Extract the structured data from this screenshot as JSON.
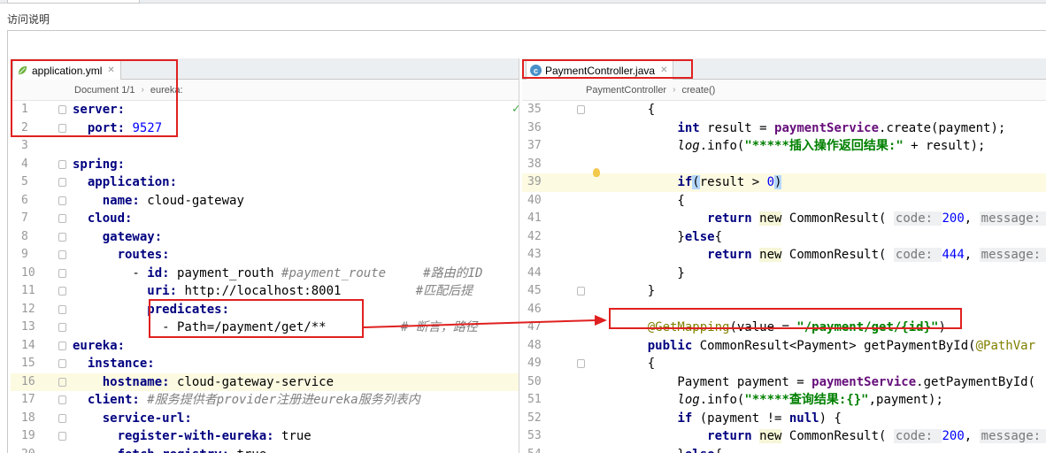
{
  "page": {
    "title": "访问说明"
  },
  "left_editor": {
    "tab_label": "application.yml",
    "breadcrumb": [
      "Document 1/1",
      "eureka:"
    ],
    "lines": [
      {
        "n": "1",
        "segs": [
          [
            "server:",
            "k"
          ]
        ]
      },
      {
        "n": "2",
        "segs": [
          [
            "  port: ",
            "k"
          ],
          [
            "9527",
            "n"
          ]
        ]
      },
      {
        "n": "3",
        "segs": []
      },
      {
        "n": "4",
        "segs": [
          [
            "spring:",
            "k"
          ]
        ]
      },
      {
        "n": "5",
        "segs": [
          [
            "  application:",
            "k"
          ]
        ]
      },
      {
        "n": "6",
        "segs": [
          [
            "    name: ",
            "k"
          ],
          [
            "cloud-gateway",
            "v"
          ]
        ]
      },
      {
        "n": "7",
        "segs": [
          [
            "  cloud:",
            "k"
          ]
        ]
      },
      {
        "n": "8",
        "segs": [
          [
            "    gateway:",
            "k"
          ]
        ]
      },
      {
        "n": "9",
        "segs": [
          [
            "      routes:",
            "k"
          ]
        ]
      },
      {
        "n": "10",
        "segs": [
          [
            "        - ",
            "v"
          ],
          [
            "id: ",
            "k"
          ],
          [
            "payment_routh ",
            "v"
          ],
          [
            "#payment_route     #路由的ID",
            "c"
          ]
        ]
      },
      {
        "n": "11",
        "segs": [
          [
            "          uri: ",
            "k"
          ],
          [
            "http://localhost:8001          ",
            "v"
          ],
          [
            "#匹配后提",
            "c"
          ]
        ]
      },
      {
        "n": "12",
        "segs": [
          [
            "          predicates:",
            "k"
          ]
        ]
      },
      {
        "n": "13",
        "segs": [
          [
            "            - Path=/payment/get/**",
            "v"
          ],
          [
            "          # 断言，路径",
            "c"
          ]
        ]
      },
      {
        "n": "14",
        "segs": [
          [
            "eureka:",
            "k"
          ]
        ]
      },
      {
        "n": "15",
        "segs": [
          [
            "  instance:",
            "k"
          ]
        ]
      },
      {
        "n": "16",
        "segs": [
          [
            "    hostname: ",
            "k"
          ],
          [
            "cloud-gateway-service",
            "v"
          ]
        ],
        "hl": true
      },
      {
        "n": "17",
        "segs": [
          [
            "  client: ",
            "k"
          ],
          [
            "#服务提供者provider注册进eureka服务列表内",
            "c"
          ]
        ]
      },
      {
        "n": "18",
        "segs": [
          [
            "    service-url:",
            "k"
          ]
        ]
      },
      {
        "n": "19",
        "segs": [
          [
            "      register-with-eureka: ",
            "k"
          ],
          [
            "true",
            "v"
          ]
        ]
      },
      {
        "n": "20",
        "segs": [
          [
            "      fetch-registry: ",
            "k"
          ],
          [
            "true",
            "v"
          ]
        ]
      }
    ]
  },
  "right_editor": {
    "tab_label": "PaymentController.java",
    "breadcrumb": [
      "PaymentController",
      "create()"
    ],
    "lines": [
      {
        "n": "35",
        "segs": [
          [
            "    {",
            "v"
          ]
        ]
      },
      {
        "n": "36",
        "segs": [
          [
            "        ",
            "v"
          ],
          [
            "int",
            "kw"
          ],
          [
            " result = ",
            "v"
          ],
          [
            "paymentService",
            "f"
          ],
          [
            ".create(payment);",
            "v"
          ]
        ]
      },
      {
        "n": "37",
        "segs": [
          [
            "        ",
            "v"
          ],
          [
            "log",
            "st"
          ],
          [
            ".info(",
            "v"
          ],
          [
            "\"*****插入操作返回结果:\"",
            "s"
          ],
          [
            " + result);",
            "v"
          ]
        ]
      },
      {
        "n": "38",
        "segs": []
      },
      {
        "n": "39",
        "segs": [
          [
            "        ",
            "v"
          ],
          [
            "if",
            "kw"
          ],
          [
            "(",
            "par"
          ],
          [
            "result > ",
            "v"
          ],
          [
            "0",
            "n"
          ],
          [
            ")",
            "par"
          ]
        ],
        "hl": true
      },
      {
        "n": "40",
        "segs": [
          [
            "        {",
            "v"
          ]
        ]
      },
      {
        "n": "41",
        "segs": [
          [
            "            ",
            "v"
          ],
          [
            "return",
            "kw"
          ],
          [
            " ",
            "v"
          ],
          [
            "new",
            "nw"
          ],
          [
            " CommonResult( ",
            "v"
          ],
          [
            "code: ",
            "hint"
          ],
          [
            "200",
            "n"
          ],
          [
            ", ",
            "v"
          ],
          [
            "message: ",
            "hint"
          ],
          [
            "\"",
            "s"
          ]
        ]
      },
      {
        "n": "42",
        "segs": [
          [
            "        }",
            "v"
          ],
          [
            "else",
            "kw"
          ],
          [
            "{",
            "v"
          ]
        ]
      },
      {
        "n": "43",
        "segs": [
          [
            "            ",
            "v"
          ],
          [
            "return",
            "kw"
          ],
          [
            " ",
            "v"
          ],
          [
            "new",
            "nw"
          ],
          [
            " CommonResult( ",
            "v"
          ],
          [
            "code: ",
            "hint"
          ],
          [
            "444",
            "n"
          ],
          [
            ", ",
            "v"
          ],
          [
            "message: ",
            "hint"
          ],
          [
            "\"",
            "s"
          ]
        ]
      },
      {
        "n": "44",
        "segs": [
          [
            "        }",
            "v"
          ]
        ]
      },
      {
        "n": "45",
        "segs": [
          [
            "    }",
            "v"
          ]
        ]
      },
      {
        "n": "46",
        "segs": []
      },
      {
        "n": "47",
        "segs": [
          [
            "    ",
            "v"
          ],
          [
            "@GetMapping",
            "anno"
          ],
          [
            "(value = ",
            "v"
          ],
          [
            "\"/payment/get/{id}\"",
            "s"
          ],
          [
            ")",
            "v"
          ]
        ]
      },
      {
        "n": "48",
        "segs": [
          [
            "    ",
            "v"
          ],
          [
            "public",
            "kw"
          ],
          [
            " CommonResult<Payment> getPaymentById(",
            "v"
          ],
          [
            "@PathVar",
            "anno"
          ]
        ]
      },
      {
        "n": "49",
        "segs": [
          [
            "    {",
            "v"
          ]
        ]
      },
      {
        "n": "50",
        "segs": [
          [
            "        Payment payment = ",
            "v"
          ],
          [
            "paymentService",
            "f"
          ],
          [
            ".getPaymentById(",
            "v"
          ]
        ]
      },
      {
        "n": "51",
        "segs": [
          [
            "        ",
            "v"
          ],
          [
            "log",
            "st"
          ],
          [
            ".info(",
            "v"
          ],
          [
            "\"*****查询结果:{}\"",
            "s"
          ],
          [
            ",payment);",
            "v"
          ]
        ]
      },
      {
        "n": "52",
        "segs": [
          [
            "        ",
            "v"
          ],
          [
            "if",
            "kw"
          ],
          [
            " (payment != ",
            "v"
          ],
          [
            "null",
            "kw"
          ],
          [
            ") {",
            "v"
          ]
        ]
      },
      {
        "n": "53",
        "segs": [
          [
            "            ",
            "v"
          ],
          [
            "return",
            "kw"
          ],
          [
            " ",
            "v"
          ],
          [
            "new",
            "nw"
          ],
          [
            " CommonResult( ",
            "v"
          ],
          [
            "code: ",
            "hint"
          ],
          [
            "200",
            "n"
          ],
          [
            ", ",
            "v"
          ],
          [
            "message: ",
            "hint"
          ],
          [
            "\"",
            "s"
          ]
        ]
      },
      {
        "n": "54",
        "segs": [
          [
            "        }",
            "v"
          ],
          [
            "else",
            "kw"
          ],
          [
            "{",
            "v"
          ]
        ]
      }
    ]
  },
  "colors": {
    "annotation_red": "#e02020"
  }
}
